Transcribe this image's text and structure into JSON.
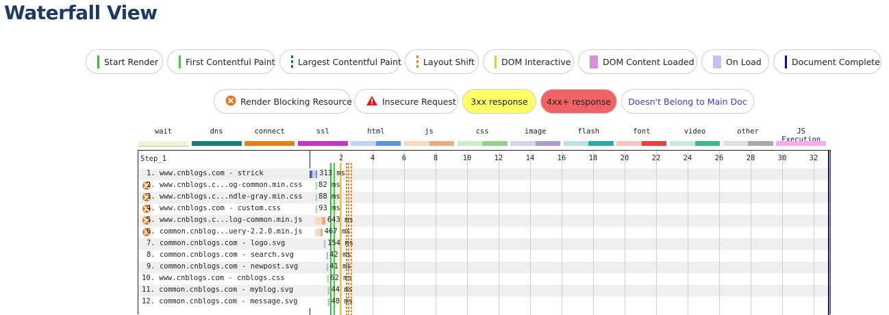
{
  "page": {
    "title": "Waterfall View"
  },
  "marker_legend": [
    {
      "label": "Start Render",
      "color": "#28c828",
      "style": "solid"
    },
    {
      "label": "First Contentful Paint",
      "color": "#38d62d",
      "style": "solid"
    },
    {
      "label": "Largest Contentful Paint",
      "color": "#1b7d1b",
      "style": "dashed"
    },
    {
      "label": "Layout Shift",
      "color": "#f08216",
      "style": "dashed"
    },
    {
      "label": "DOM Interactive",
      "color": "#f2c534",
      "style": "solid"
    },
    {
      "label": "DOM Content Loaded",
      "color": "#d78fdd",
      "style": "block"
    },
    {
      "label": "On Load",
      "color": "#c4c2f5",
      "style": "block"
    },
    {
      "label": "Document Complete",
      "color": "#0a0aa8",
      "style": "solid"
    }
  ],
  "request_legend": [
    {
      "label": "Render Blocking Resource",
      "icon": "render-blocking-icon"
    },
    {
      "label": "Insecure Request",
      "icon": "warning-icon"
    },
    {
      "label": "3xx response",
      "bg": "#ffff66"
    },
    {
      "label": "4xx+ response",
      "bg": "#f06263"
    },
    {
      "label": "Doesn't Belong to Main Doc",
      "color": "#3a3ad0"
    }
  ],
  "type_legend": [
    {
      "label": "wait",
      "colors": [
        "#f0f3d4",
        "#f0f3d4"
      ]
    },
    {
      "label": "dns",
      "colors": [
        "#1a7b79",
        "#1a7b79"
      ]
    },
    {
      "label": "connect",
      "colors": [
        "#e47f1c",
        "#e47f1c"
      ]
    },
    {
      "label": "ssl",
      "colors": [
        "#c437c4",
        "#c437c4"
      ]
    },
    {
      "label": "html",
      "colors": [
        "#c1d3f2",
        "#5d94de"
      ]
    },
    {
      "label": "js",
      "colors": [
        "#f6dbc3",
        "#e8ad7c"
      ]
    },
    {
      "label": "css",
      "colors": [
        "#c8edc8",
        "#91d288"
      ]
    },
    {
      "label": "image",
      "colors": [
        "#dad0ea",
        "#b19ace"
      ]
    },
    {
      "label": "flash",
      "colors": [
        "#bde2e2",
        "#2fa6aa"
      ]
    },
    {
      "label": "font",
      "colors": [
        "#f7c2c2",
        "#e8423e"
      ]
    },
    {
      "label": "video",
      "colors": [
        "#c5e8df",
        "#3bb893"
      ]
    },
    {
      "label": "other",
      "colors": [
        "#e0e0e0",
        "#a9a9a9"
      ]
    },
    {
      "label": "JS Execution",
      "colors": [
        "#fba8f3",
        "#fba8f3"
      ]
    }
  ],
  "waterfall": {
    "step": "Step_1",
    "axis_max": 33,
    "ticks": [
      "2",
      "4",
      "6",
      "8",
      "10",
      "12",
      "14",
      "16",
      "18",
      "20",
      "22",
      "24",
      "26",
      "28",
      "30",
      "32"
    ],
    "markers": {
      "start_render": 1.3,
      "first_contentful_paint": 1.5,
      "dom_interactive": 1.9,
      "layout_shift": [
        2.3,
        2.45,
        2.6
      ],
      "document_complete": 33.0
    },
    "requests": [
      {
        "label": "1. www.cnblogs.com - strick",
        "start": 0.0,
        "duration_ms": 313,
        "duration": "313 ms",
        "type": "html",
        "blocking": false
      },
      {
        "label": "2. www.cnblogs.c...og-common.min.css",
        "start": 0.35,
        "duration_ms": 82,
        "duration": "82 ms",
        "type": "css",
        "blocking": true
      },
      {
        "label": "3. www.cnblogs.c...ndle-gray.min.css",
        "start": 0.35,
        "duration_ms": 88,
        "duration": "88 ms",
        "type": "css",
        "blocking": true
      },
      {
        "label": "4. www.cnblogs.com - custom.css",
        "start": 0.35,
        "duration_ms": 93,
        "duration": "93 ms",
        "type": "css",
        "blocking": true
      },
      {
        "label": "5. www.cnblogs.c...log-common.min.js",
        "start": 0.35,
        "duration_ms": 643,
        "duration": "643 ms",
        "type": "js",
        "blocking": true
      },
      {
        "label": "6. common.cnblog...uery-2.2.0.min.js",
        "start": 0.35,
        "duration_ms": 467,
        "duration": "467 ms",
        "type": "js",
        "blocking": true
      },
      {
        "label": "7. common.cnblogs.com - logo.svg",
        "start": 0.85,
        "duration_ms": 154,
        "duration": "154 ms",
        "type": "image",
        "blocking": false
      },
      {
        "label": "8. common.cnblogs.com - search.svg",
        "start": 1.05,
        "duration_ms": 42,
        "duration": "42 ms",
        "type": "image",
        "blocking": false
      },
      {
        "label": "9. common.cnblogs.com - newpost.svg",
        "start": 1.05,
        "duration_ms": 41,
        "duration": "41 ms",
        "type": "image",
        "blocking": false
      },
      {
        "label": "10. www.cnblogs.com - cnblogs.css",
        "start": 1.1,
        "duration_ms": 62,
        "duration": "62 ms",
        "type": "css",
        "blocking": false
      },
      {
        "label": "11. common.cnblogs.com - myblog.svg",
        "start": 1.15,
        "duration_ms": 44,
        "duration": "44 ms",
        "type": "image",
        "blocking": false
      },
      {
        "label": "12. common.cnblogs.com - message.svg",
        "start": 1.15,
        "duration_ms": 48,
        "duration": "48 ms",
        "type": "image",
        "blocking": false
      }
    ]
  }
}
